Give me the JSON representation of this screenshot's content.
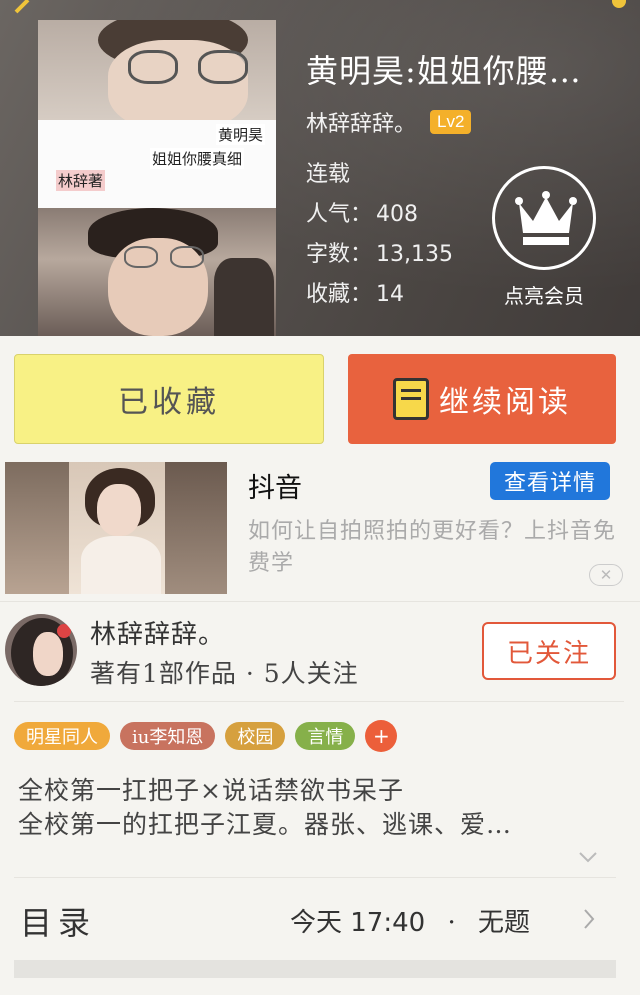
{
  "book": {
    "title": "黄明昊:姐姐你腰…",
    "author": "林辞辞辞。",
    "level": "Lv2",
    "status": "连载",
    "stats": {
      "popularity_label": "人气：",
      "popularity": "408",
      "words_label": "字数：",
      "words": "13,135",
      "favorites_label": "收藏：",
      "favorites": "14"
    },
    "cover_captions": [
      "黄明昊",
      "姐姐你腰真细",
      "林辞著"
    ]
  },
  "vip": {
    "label": "点亮会员"
  },
  "actions": {
    "favorited_label": "已收藏",
    "continue_label": "继续阅读"
  },
  "ad": {
    "title": "抖音",
    "detail_label": "查看详情",
    "description": "如何让自拍照拍的更好看？上抖音免费学",
    "close": "✕"
  },
  "author_card": {
    "name": "林辞辞辞。",
    "meta": "著有1部作品 · 5人关注",
    "follow_label": "已关注"
  },
  "tags": [
    "明星同人",
    "iu李知恩",
    "校园",
    "言情"
  ],
  "tag_more": "+",
  "synopsis": {
    "line1": "全校第一扛把子×说话禁欲书呆子",
    "line2": "全校第一的扛把子江夏。器张、逃课、爱…"
  },
  "toc": {
    "title": "目录",
    "latest_time": "今天 17:40",
    "separator": "·",
    "latest_chapter": "无题"
  },
  "colors": {
    "favorite_button": "#f8f185",
    "read_button": "#e8623e",
    "detail_button": "#2177db",
    "level_badge": "#f4b02a",
    "follow_border": "#e2583a"
  }
}
